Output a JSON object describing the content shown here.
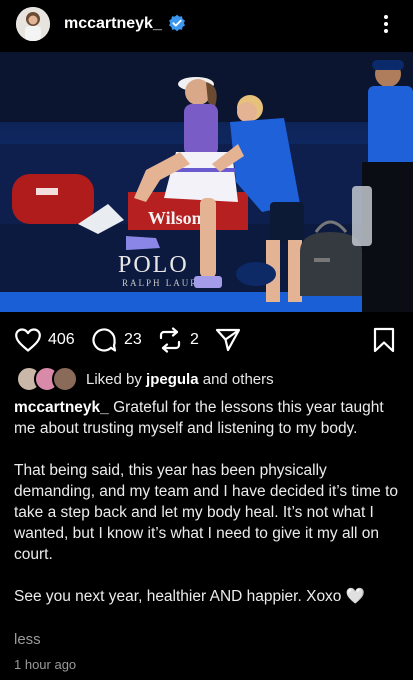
{
  "post": {
    "username": "mccartneyk_",
    "likes_count": "406",
    "comments_count": "23",
    "reposts_count": "2",
    "liked_by_prefix": "Liked by",
    "liked_by_user": "jpegula",
    "liked_by_suffix": "and others",
    "caption_user": "mccartneyk_",
    "caption_p1": "Grateful for the lessons this year taught me about trusting myself and listening to my body.",
    "caption_p2": "That being said, this year has been physically demanding, and my team and I have decided it’s time to take a step back and let my body heal. It’s not what I wanted, but I know it’s what I need to give it my all on court.",
    "caption_p3": "See you next year, healthier AND happier. Xoxo",
    "caption_emoji": "🤍",
    "less_label": "less",
    "timestamp": "1 hour ago"
  },
  "photo": {
    "signage_brand": "POLO",
    "signage_sub": "RALPH LAUREN",
    "bag_brand": "Wilson"
  },
  "icons": {
    "verified": "verified-badge-icon",
    "more": "more-vertical-icon",
    "like": "heart-icon",
    "comment": "comment-icon",
    "repost": "repost-icon",
    "share": "send-icon",
    "save": "bookmark-icon"
  },
  "colors": {
    "background": "#000000",
    "verified": "#3b97f0",
    "text_secondary": "#9a9a9a"
  }
}
